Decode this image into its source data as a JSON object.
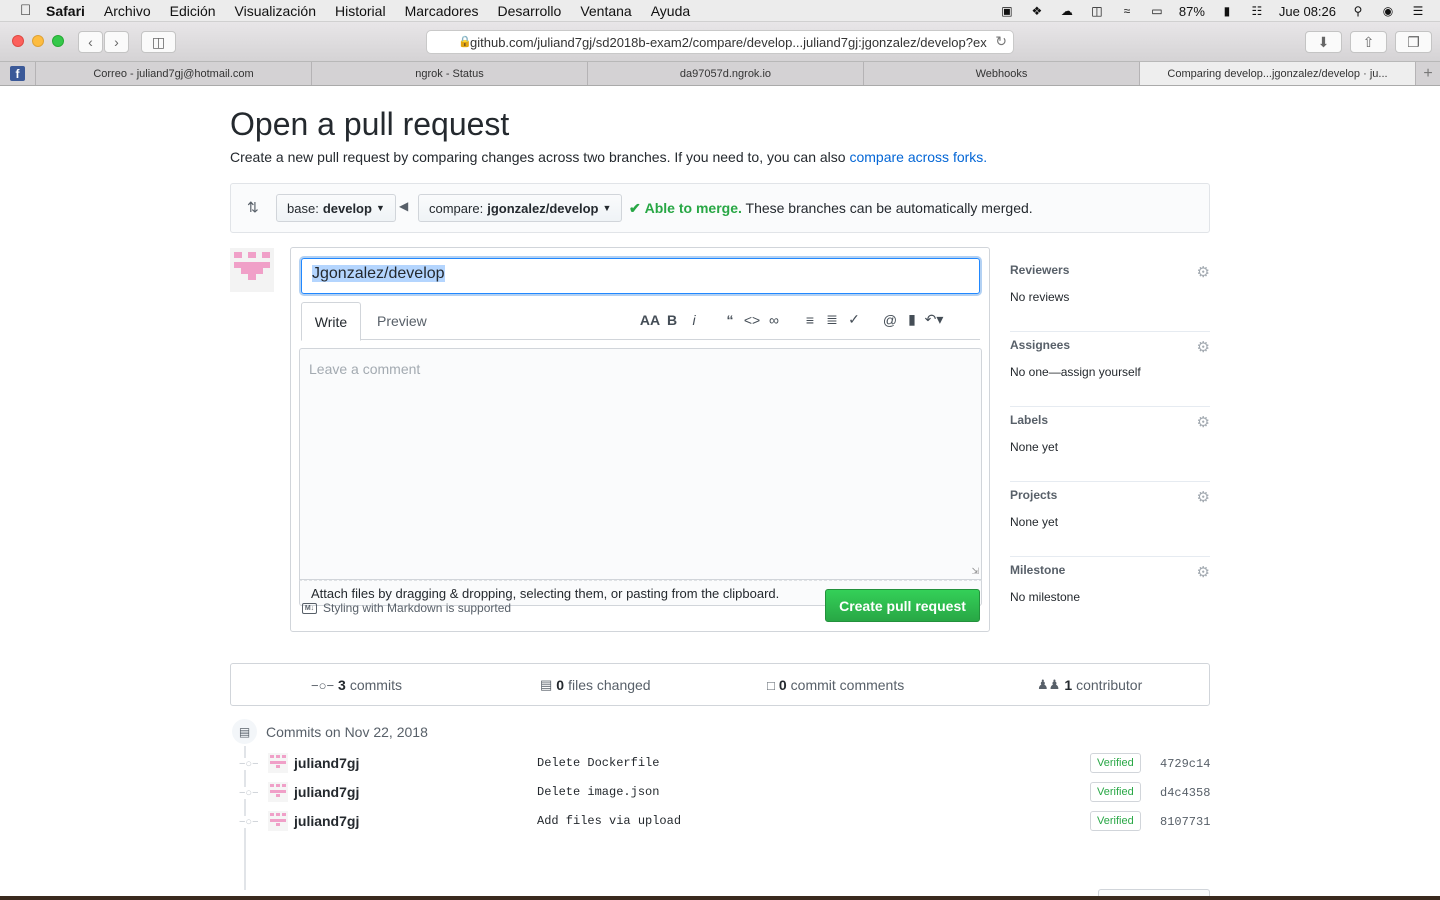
{
  "menubar": {
    "apple": "",
    "items": [
      "Safari",
      "Archivo",
      "Edición",
      "Visualización",
      "Historial",
      "Marcadores",
      "Desarrollo",
      "Ventana",
      "Ayuda"
    ],
    "battery": "87%",
    "clock": "Jue 08:26"
  },
  "browser": {
    "url": "github.com/juliand7gj/sd2018b-exam2/compare/develop...juliand7gj:jgonzalez/develop?ex",
    "tabs": [
      "Correo - juliand7gj@hotmail.com",
      "ngrok - Status",
      "da97057d.ngrok.io",
      "Webhooks",
      "Comparing develop...jgonzalez/develop · ju..."
    ],
    "favicon_letter": "f"
  },
  "page": {
    "title": "Open a pull request",
    "subtitle": "Create a new pull request by comparing changes across two branches. If you need to, you can also ",
    "subtitle_link": "compare across forks.",
    "base_label": "base:",
    "base_branch": "develop",
    "compare_label": "compare:",
    "compare_branch": "jgonzalez/develop",
    "merge_ok": "Able to merge.",
    "merge_text": " These branches can be automatically merged."
  },
  "compose": {
    "title_value": "Jgonzalez/develop",
    "tab_write": "Write",
    "tab_preview": "Preview",
    "comment_placeholder": "Leave a comment",
    "attach_text": "Attach files by dragging & dropping, selecting them, or pasting from the clipboard.",
    "markdown_note": "Styling with Markdown is supported",
    "markdown_badge": "M↓",
    "create_button": "Create pull request"
  },
  "sidebar": {
    "sections": [
      {
        "heading": "Reviewers",
        "value": "No reviews"
      },
      {
        "heading": "Assignees",
        "value": "No one—assign yourself"
      },
      {
        "heading": "Labels",
        "value": "None yet"
      },
      {
        "heading": "Projects",
        "value": "None yet"
      },
      {
        "heading": "Milestone",
        "value": "No milestone"
      }
    ]
  },
  "numbers": {
    "commits_count": "3",
    "commits_label": "commits",
    "files_count": "0",
    "files_label": "files changed",
    "comments_count": "0",
    "comments_label": "commit comments",
    "contributors_count": "1",
    "contributors_label": "contributor"
  },
  "commits": {
    "group_title": "Commits on Nov 22, 2018",
    "verified_label": "Verified",
    "rows": [
      {
        "author": "juliand7gj",
        "message": "Delete Dockerfile",
        "sha": "4729c14"
      },
      {
        "author": "juliand7gj",
        "message": "Delete image.json",
        "sha": "d4c4358"
      },
      {
        "author": "juliand7gj",
        "message": "Add files via upload",
        "sha": "8107731"
      }
    ]
  },
  "colors": {
    "accent_blue": "#0366d6",
    "success_green": "#28a745",
    "identicon_pink": "#f0a0c8"
  }
}
